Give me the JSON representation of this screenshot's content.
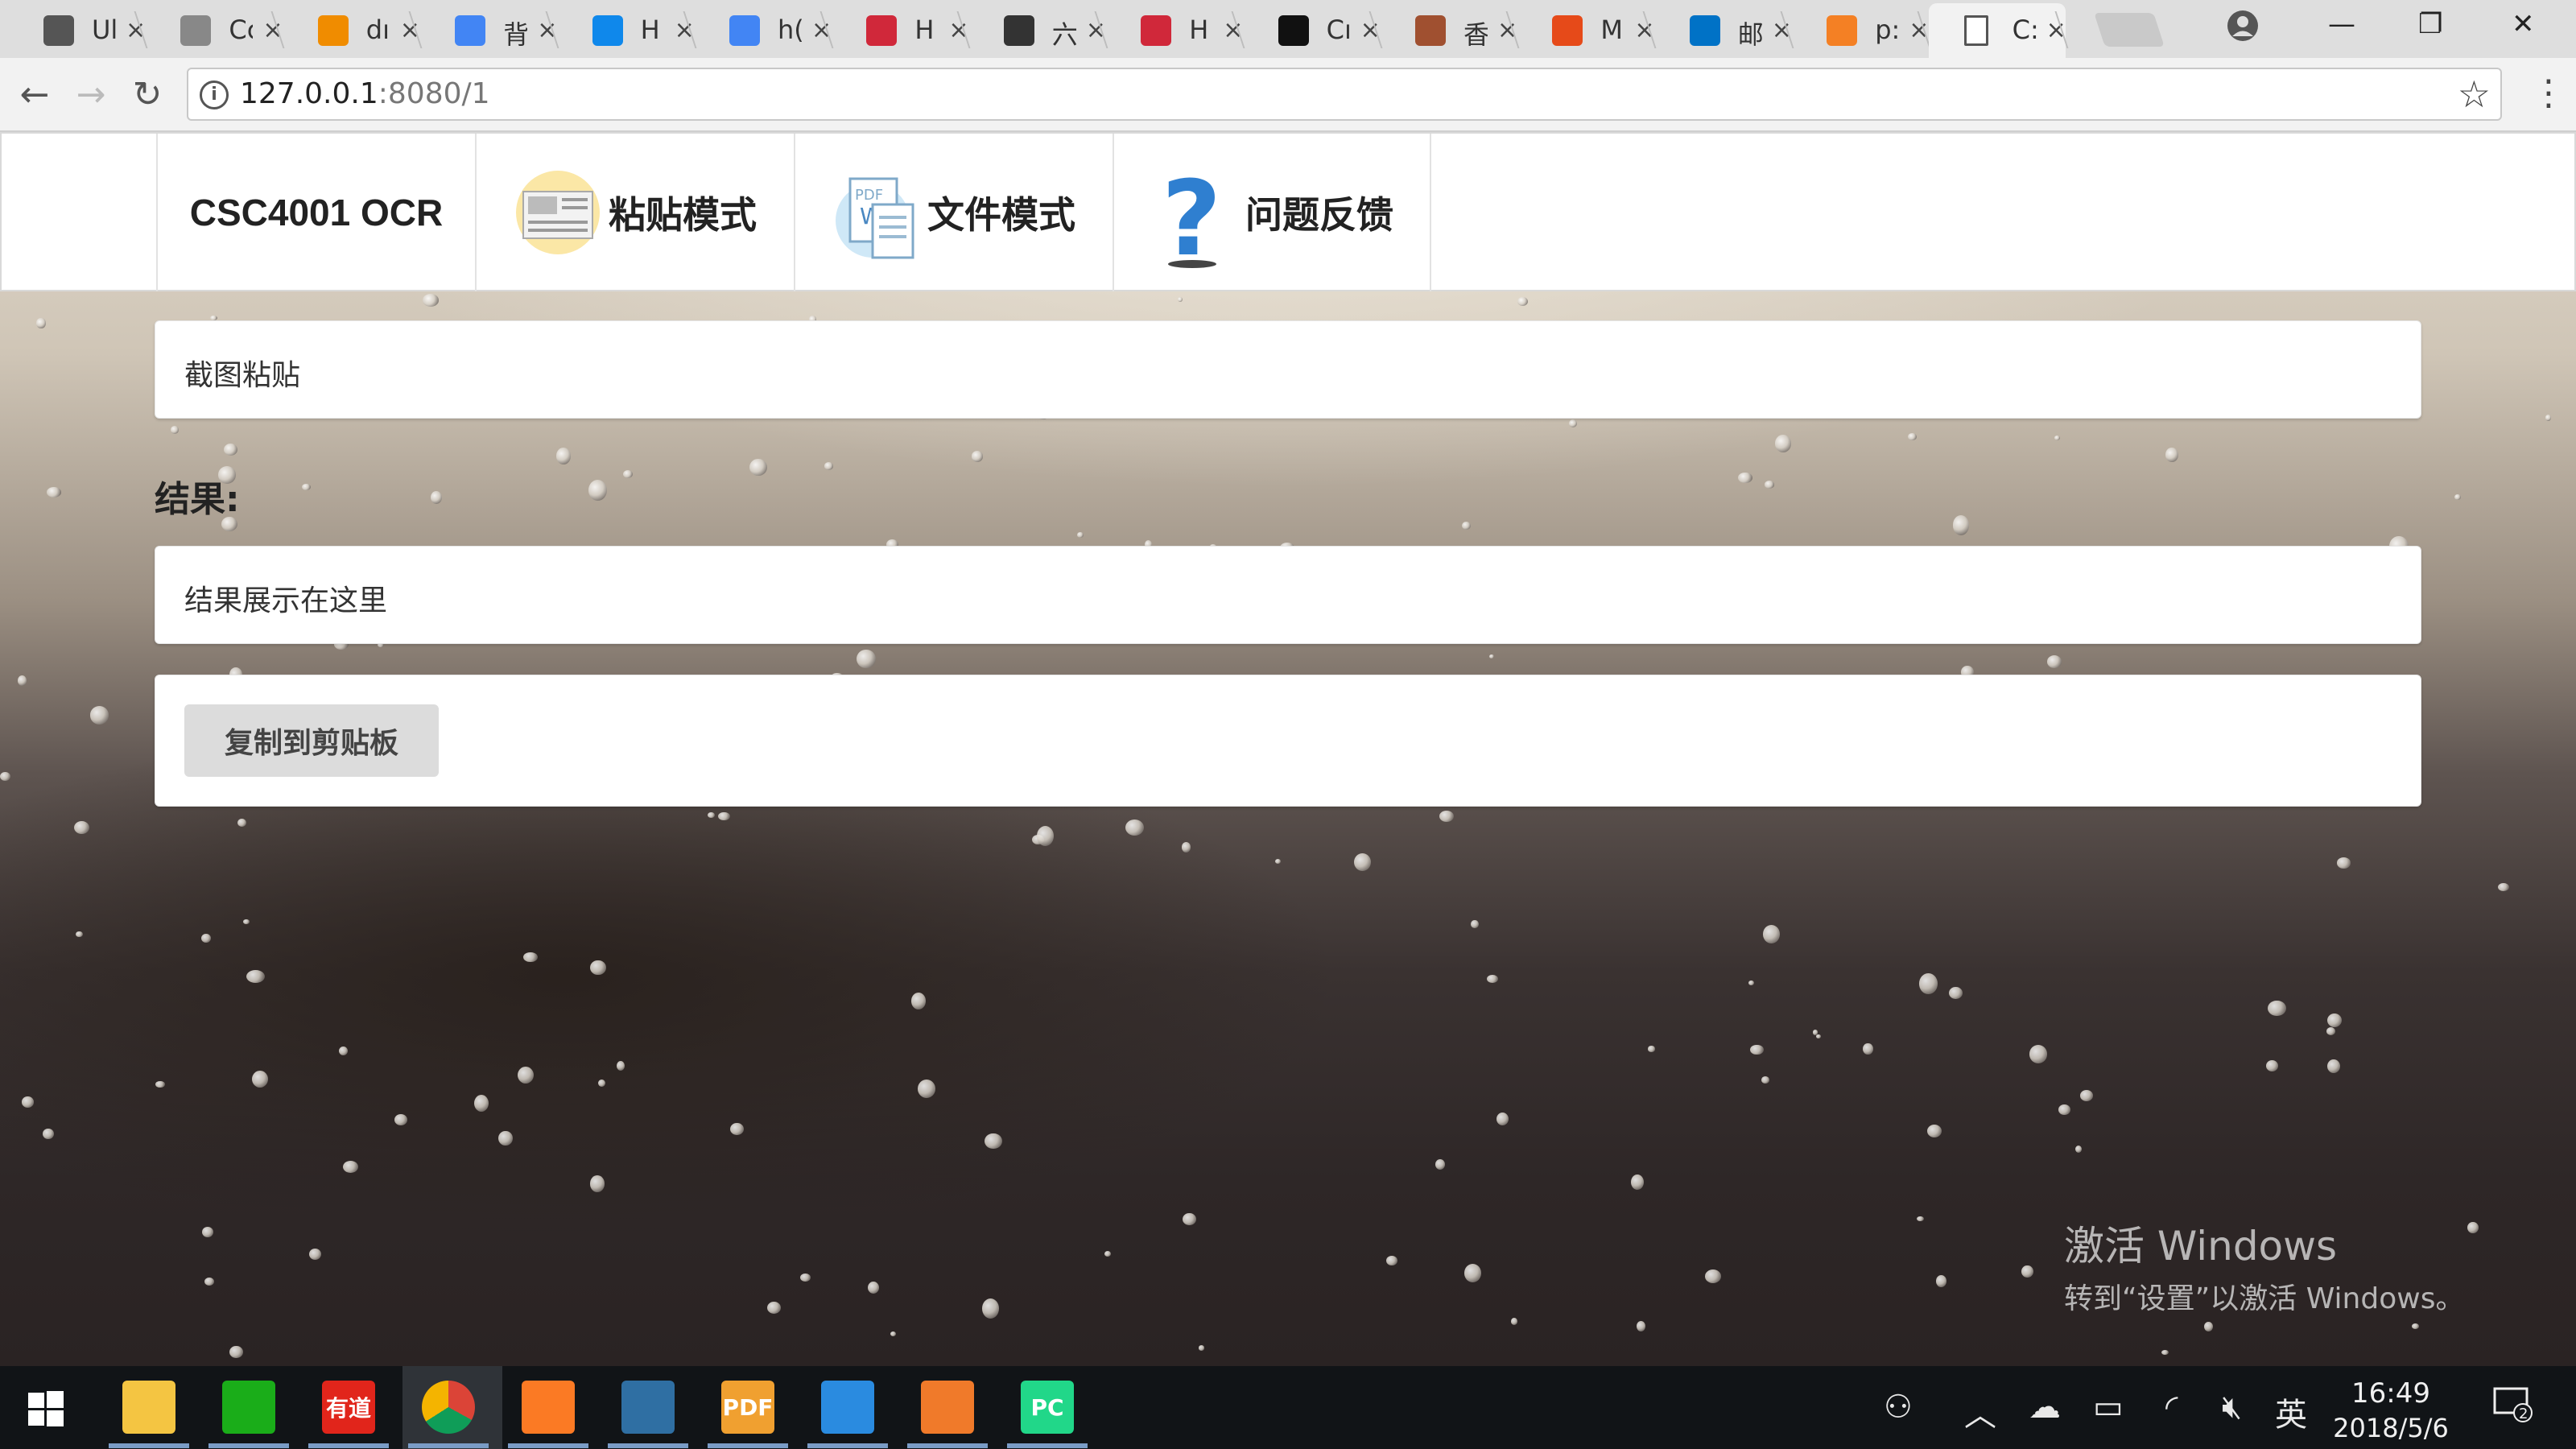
{
  "browser": {
    "tabs": [
      {
        "title": "Ul",
        "icon": "feather-icon",
        "color": "#555555"
      },
      {
        "title": "Cc",
        "icon": "logo-icon",
        "color": "#888888"
      },
      {
        "title": "dı",
        "icon": "orange-grid-icon",
        "color": "#f08c00"
      },
      {
        "title": "背",
        "icon": "google-icon",
        "color": "#4285f4"
      },
      {
        "title": "H",
        "icon": "zhihu-icon",
        "color": "#0f88eb"
      },
      {
        "title": "h(",
        "icon": "google-icon",
        "color": "#4285f4"
      },
      {
        "title": "H",
        "icon": "red-hex-icon",
        "color": "#d0283a"
      },
      {
        "title": "六",
        "icon": "w3c-icon",
        "color": "#333333"
      },
      {
        "title": "H",
        "icon": "red-hex-icon",
        "color": "#d0283a"
      },
      {
        "title": "Cı",
        "icon": "github-icon",
        "color": "#111111"
      },
      {
        "title": "香",
        "icon": "crest-icon",
        "color": "#a05030"
      },
      {
        "title": "M",
        "icon": "office-icon",
        "color": "#e64a19"
      },
      {
        "title": "邮",
        "icon": "outlook-icon",
        "color": "#0072c6"
      },
      {
        "title": "p:",
        "icon": "stackoverflow-icon",
        "color": "#f48024"
      },
      {
        "title": "C:",
        "icon": "document-icon",
        "color": "#ffffff",
        "active": true
      }
    ],
    "url_host": "127.0.0.1",
    "url_path": ":8080/1",
    "info_symbol": "i"
  },
  "navbar": {
    "brand": "CSC4001 OCR",
    "items": [
      {
        "label": "粘贴模式",
        "icon": "newspaper-icon"
      },
      {
        "label": "文件模式",
        "icon": "document-files-icon"
      },
      {
        "label": "问题反馈",
        "icon": "question-mark-icon"
      }
    ]
  },
  "main": {
    "paste_placeholder": "截图粘贴",
    "result_heading": "结果:",
    "result_placeholder": "结果展示在这里",
    "copy_button": "复制到剪贴板"
  },
  "watermark": {
    "line1": "激活 Windows",
    "line2": "转到“设置”以激活 Windows。"
  },
  "taskbar": {
    "apps": [
      {
        "name": "file-explorer-icon",
        "color": "#f4c542"
      },
      {
        "name": "wechat-icon",
        "color": "#1aad19"
      },
      {
        "name": "youdao-icon",
        "color": "#e1251b",
        "text": "有道"
      },
      {
        "name": "chrome-icon",
        "color": "#4285f4"
      },
      {
        "name": "xampp-icon",
        "color": "#fb7a24"
      },
      {
        "name": "mysql-workbench-icon",
        "color": "#2f6fa3"
      },
      {
        "name": "pdf-icon",
        "color": "#f0a030",
        "text": "PDF"
      },
      {
        "name": "wps-icon",
        "color": "#2a8be0"
      },
      {
        "name": "powerpoint-icon",
        "color": "#f07a2a"
      },
      {
        "name": "pycharm-icon",
        "color": "#21d789",
        "text": "PC"
      }
    ],
    "ime": "英",
    "time": "16:49",
    "date": "2018/5/6",
    "notifications": "2"
  }
}
